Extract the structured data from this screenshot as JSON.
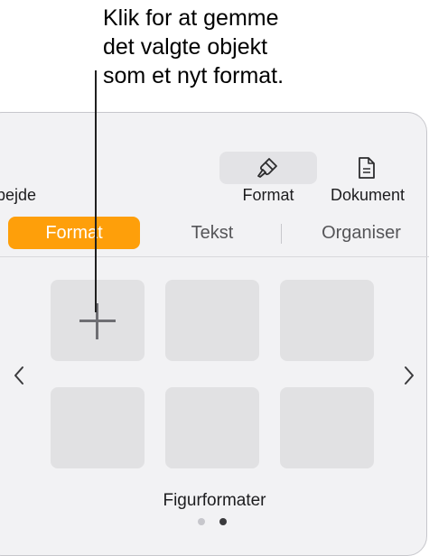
{
  "callout": {
    "lines": [
      "Klik for at gemme",
      "det valgte objekt",
      "som et nyt format."
    ]
  },
  "toolbar": {
    "left_label": "pejde",
    "format_label": "Format",
    "format_icon": "paintbrush-icon",
    "document_label": "Dokument",
    "document_icon": "document-icon"
  },
  "tabs": [
    {
      "label": "Format",
      "active": true
    },
    {
      "label": "Tekst",
      "active": false
    },
    {
      "label": "Organiser",
      "active": false
    }
  ],
  "styles_grid": {
    "add_icon": "plus-icon",
    "caption": "Figurformater",
    "page_dots": {
      "count": 2,
      "current": 2
    }
  },
  "colors": {
    "accent": "#fe9f0a",
    "panel_bg": "#f2f2f4",
    "tile_bg": "#e1e1e3"
  }
}
